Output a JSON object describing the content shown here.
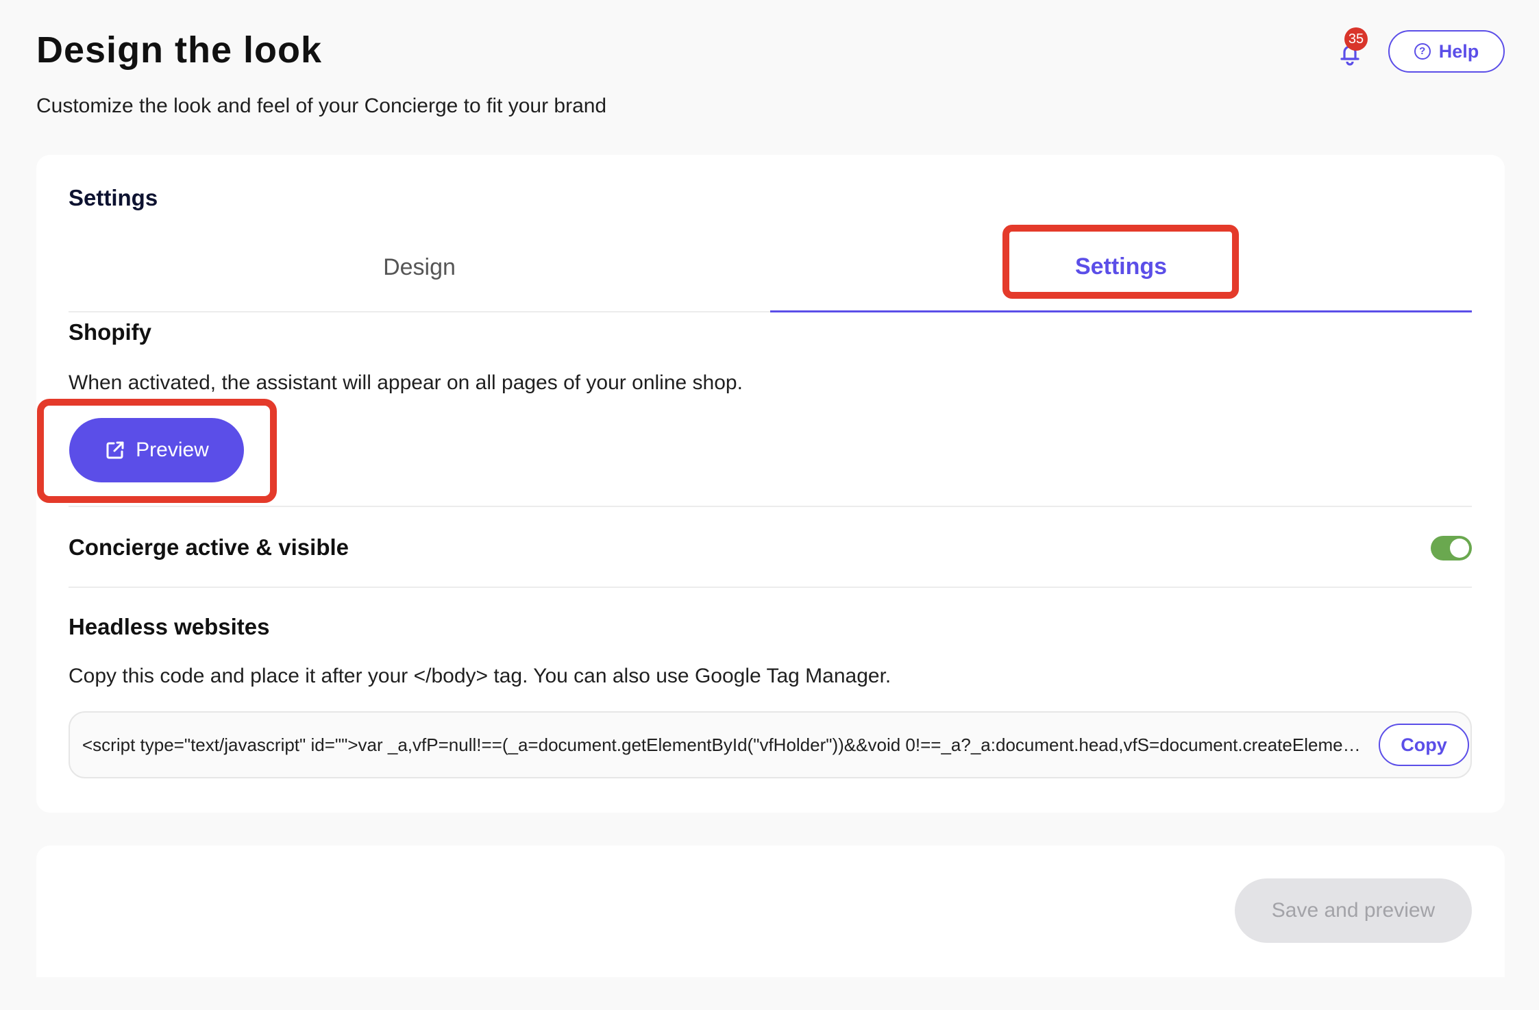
{
  "header": {
    "title": "Design the look",
    "subtitle": "Customize the look and feel of your Concierge to fit your brand",
    "notification_count": "35",
    "help_label": "Help"
  },
  "settings_card": {
    "heading": "Settings",
    "tabs": [
      {
        "label": "Design",
        "active": false
      },
      {
        "label": "Settings",
        "active": true
      }
    ],
    "shopify": {
      "title": "Shopify",
      "description": "When activated, the assistant will appear on all pages of your online shop.",
      "preview_label": "Preview"
    },
    "concierge": {
      "title": "Concierge active & visible",
      "toggle_on": true
    },
    "headless": {
      "title": "Headless websites",
      "description": "Copy this code and place it after your </body> tag. You can also use Google Tag Manager.",
      "code": "<script type=\"text/javascript\" id=\"\">var _a,vfP=null!==(_a=document.getElementById(\"vfHolder\"))&&void 0!==_a?_a:document.head,vfS=document.createElement(\"script\");",
      "copy_label": "Copy"
    }
  },
  "footer": {
    "save_label": "Save and preview"
  },
  "colors": {
    "accent": "#5b4ee8",
    "highlight": "#e43a2a",
    "toggle": "#6aa84f",
    "badge": "#d9352b"
  }
}
